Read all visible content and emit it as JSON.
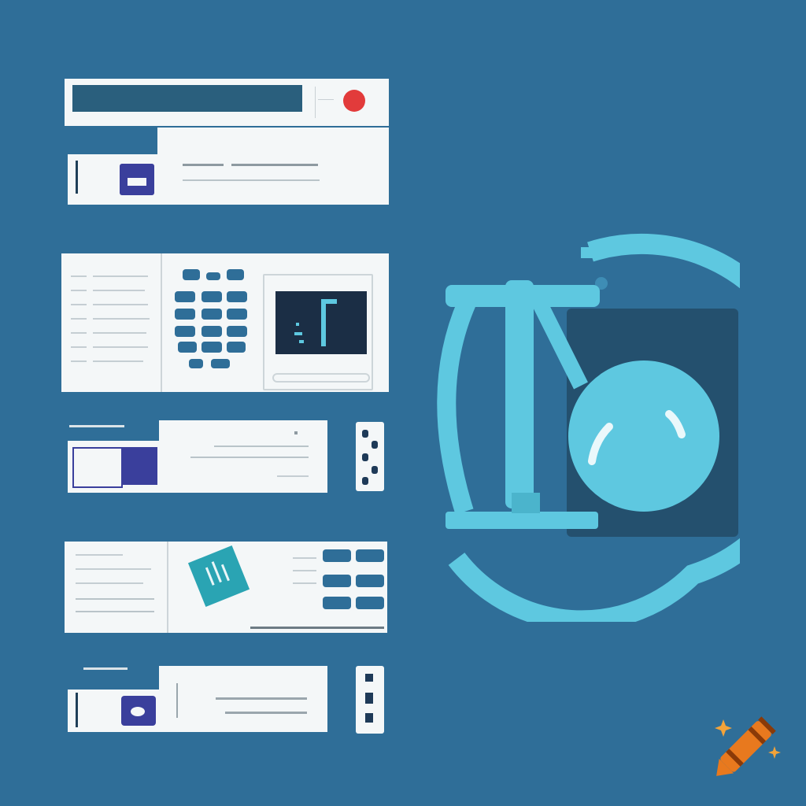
{
  "colors": {
    "background": "#2f6e98",
    "panel": "#f4f7f8",
    "panel_shadow": "#2a5f7d",
    "accent_cyan": "#5ec8e0",
    "dark_square": "#24506e",
    "red_record": "#e23b3b",
    "icon_purple": "#3a3f9c",
    "crayon_orange": "#e8791e"
  },
  "icons": {
    "record_button": "red-record-icon",
    "main_logo": "cyan-arcs-and-sphere-logo",
    "watermark": "crayon-watermark-icon"
  },
  "labels": {
    "row3_caption": "",
    "row5_caption": ""
  }
}
